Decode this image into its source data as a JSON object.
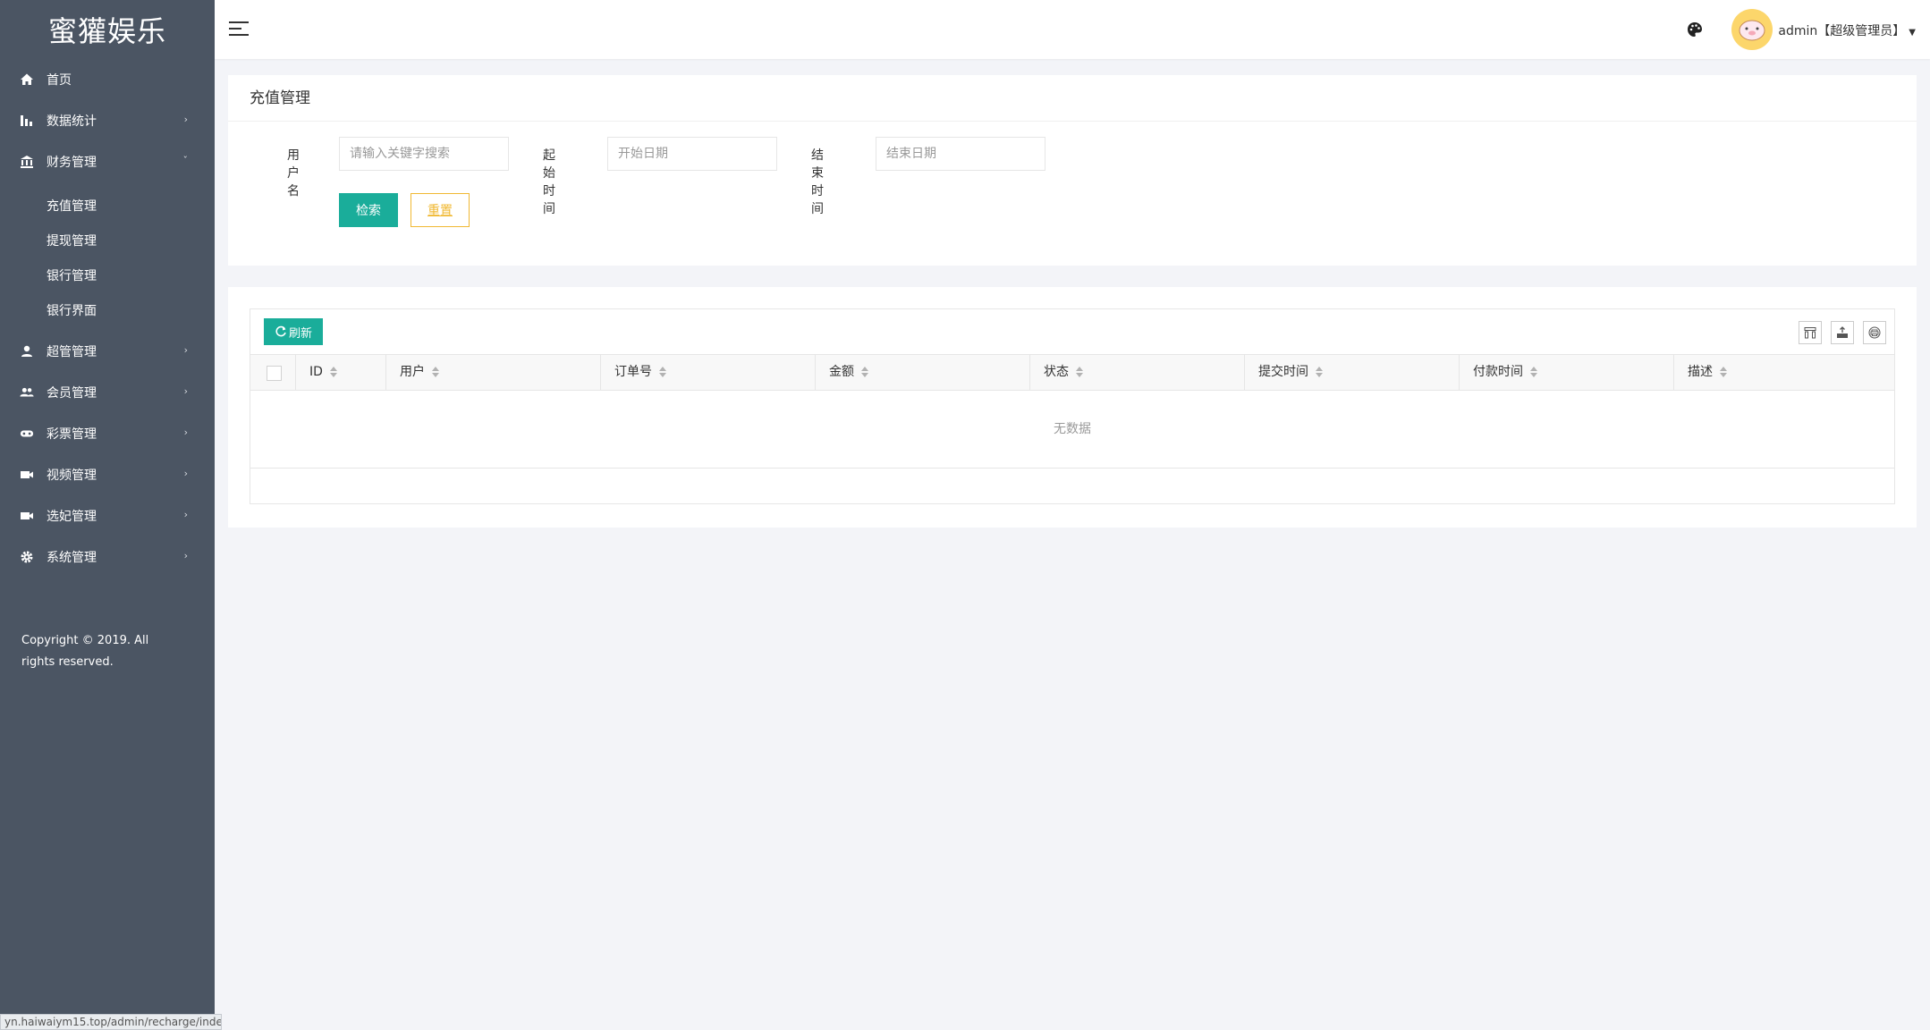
{
  "brand": "蜜獾娱乐",
  "sidebar": {
    "items": [
      {
        "label": "首页",
        "icon": "home-icon"
      },
      {
        "label": "数据统计",
        "icon": "bar-chart-icon"
      },
      {
        "label": "财务管理",
        "icon": "bank-icon",
        "expanded": true,
        "children": [
          "充值管理",
          "提现管理",
          "银行管理",
          "银行界面"
        ]
      },
      {
        "label": "超管管理",
        "icon": "user-icon"
      },
      {
        "label": "会员管理",
        "icon": "users-icon"
      },
      {
        "label": "彩票管理",
        "icon": "gamepad-icon"
      },
      {
        "label": "视频管理",
        "icon": "video-icon"
      },
      {
        "label": "选妃管理",
        "icon": "video-icon"
      },
      {
        "label": "系统管理",
        "icon": "gear-icon"
      }
    ],
    "copyright": "Copyright © 2019. All rights reserved."
  },
  "header": {
    "user": "admin【超级管理员】"
  },
  "page": {
    "title": "充值管理",
    "filters": {
      "username_label": "用户名",
      "username_placeholder": "请输入关键字搜索",
      "start_label": "起始时间",
      "start_placeholder": "开始日期",
      "end_label": "结束时间",
      "end_placeholder": "结束日期"
    },
    "search_button": "检索",
    "reset_button": "重置"
  },
  "table": {
    "refresh_button": "刷新",
    "columns": [
      "ID",
      "用户",
      "订单号",
      "金额",
      "状态",
      "提交时间",
      "付款时间",
      "描述"
    ],
    "empty_text": "无数据"
  },
  "status_url": "yn.haiwaiym15.top/admin/recharge/index",
  "colors": {
    "sidebar": "#4b5563",
    "primary": "#1aad9a",
    "warn": "#f0b832",
    "background": "#f3f4f8"
  }
}
